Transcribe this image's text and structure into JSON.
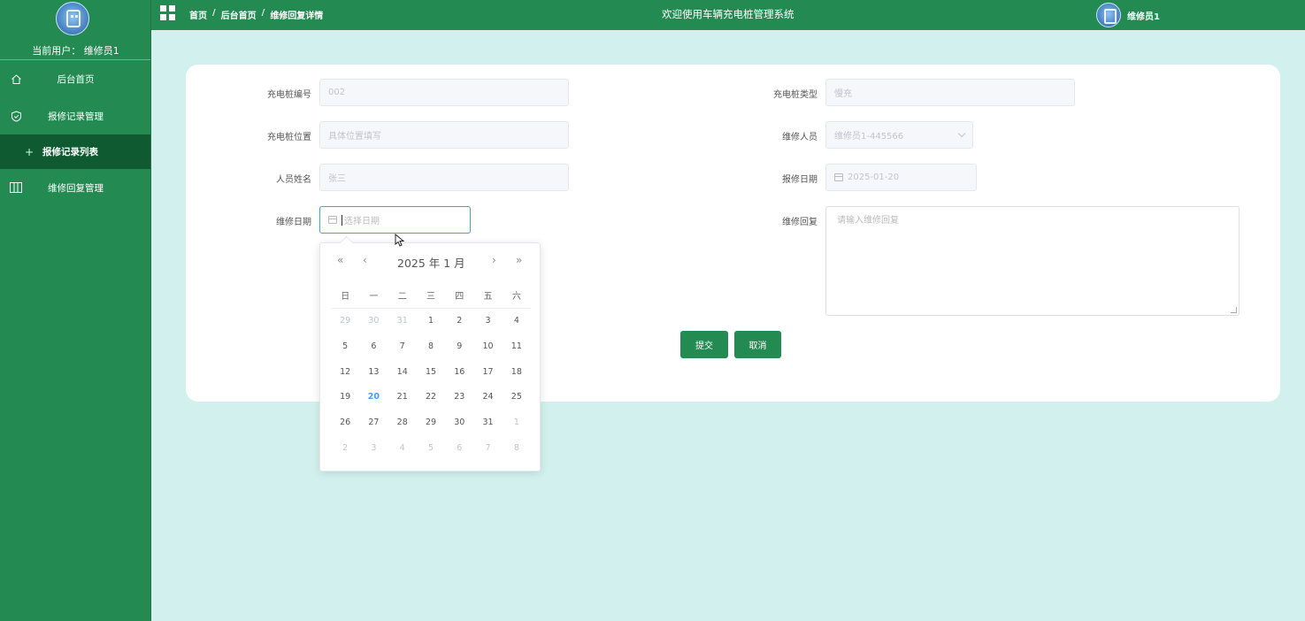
{
  "sidebar": {
    "current_user": "当前用户：  维修员1",
    "items": [
      {
        "label": "后台首页",
        "icon": "home-icon"
      },
      {
        "label": "报修记录管理",
        "icon": "shield-icon"
      },
      {
        "label": "报修记录列表",
        "icon": "plus-icon"
      },
      {
        "label": "维修回复管理",
        "icon": "columns-icon"
      }
    ]
  },
  "header": {
    "breadcrumb": [
      "首页",
      "后台首页",
      "维修回复详情"
    ],
    "separator": "/",
    "title": "欢迎使用车辆充电桩管理系统",
    "user": "维修员1"
  },
  "form": {
    "pile_no": {
      "label": "充电桩编号",
      "value": "002"
    },
    "pile_type": {
      "label": "充电桩类型",
      "value": "慢充"
    },
    "pile_location": {
      "label": "充电桩位置",
      "value": "具体位置填写"
    },
    "repairer": {
      "label": "维修人员",
      "value": "维修员1-445566"
    },
    "person_name": {
      "label": "人员姓名",
      "value": "张三"
    },
    "report_date": {
      "label": "报修日期",
      "value": "2025-01-20"
    },
    "repair_date": {
      "label": "维修日期",
      "placeholder": "选择日期"
    },
    "repair_reply": {
      "label": "维修回复",
      "placeholder": "请输入维修回复"
    },
    "submit_label": "提交",
    "cancel_label": "取消"
  },
  "datepicker": {
    "title": "2025 年  1 月",
    "prev_year": "«",
    "prev_month": "‹",
    "next_month": "›",
    "next_year": "»",
    "weekdays": [
      "日",
      "一",
      "二",
      "三",
      "四",
      "五",
      "六"
    ],
    "days": [
      {
        "d": "29",
        "t": "other"
      },
      {
        "d": "30",
        "t": "other"
      },
      {
        "d": "31",
        "t": "other"
      },
      {
        "d": "1"
      },
      {
        "d": "2"
      },
      {
        "d": "3"
      },
      {
        "d": "4"
      },
      {
        "d": "5"
      },
      {
        "d": "6"
      },
      {
        "d": "7"
      },
      {
        "d": "8"
      },
      {
        "d": "9"
      },
      {
        "d": "10"
      },
      {
        "d": "11"
      },
      {
        "d": "12"
      },
      {
        "d": "13"
      },
      {
        "d": "14"
      },
      {
        "d": "15"
      },
      {
        "d": "16"
      },
      {
        "d": "17"
      },
      {
        "d": "18"
      },
      {
        "d": "19"
      },
      {
        "d": "20",
        "t": "today"
      },
      {
        "d": "21"
      },
      {
        "d": "22"
      },
      {
        "d": "23"
      },
      {
        "d": "24"
      },
      {
        "d": "25"
      },
      {
        "d": "26"
      },
      {
        "d": "27"
      },
      {
        "d": "28"
      },
      {
        "d": "29"
      },
      {
        "d": "30"
      },
      {
        "d": "31"
      },
      {
        "d": "1",
        "t": "other"
      },
      {
        "d": "2",
        "t": "other"
      },
      {
        "d": "3",
        "t": "other"
      },
      {
        "d": "4",
        "t": "other"
      },
      {
        "d": "5",
        "t": "other"
      },
      {
        "d": "6",
        "t": "other"
      },
      {
        "d": "7",
        "t": "other"
      },
      {
        "d": "8",
        "t": "other"
      }
    ]
  },
  "colors": {
    "primary": "#238a52",
    "background": "#d2f1ee",
    "today": "#409eff"
  }
}
